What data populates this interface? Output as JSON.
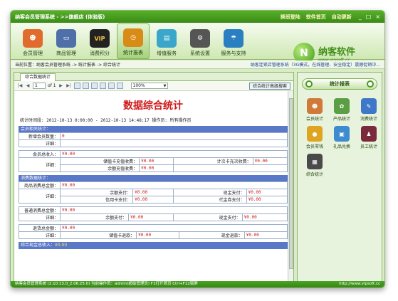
{
  "window": {
    "title": "纳客会员管理系统 - >>旗舰店 (体验版)",
    "links": [
      "换班登陆",
      "软件首页",
      "自动更新"
    ],
    "controls": [
      "_",
      "□",
      "×"
    ]
  },
  "toolbar": {
    "items": [
      {
        "label": "会员管理",
        "icon": "members-icon",
        "color": "#e06b2c"
      },
      {
        "label": "商品管理",
        "icon": "monitor-icon",
        "color": "#4f6fa8"
      },
      {
        "label": "消费积分",
        "icon": "vip-icon",
        "color": "#222222",
        "glyph": "VIP"
      },
      {
        "label": "统计报表",
        "icon": "clock-chart-icon",
        "color": "#d98b17"
      },
      {
        "label": "增值服务",
        "icon": "cards-new-icon",
        "color": "#3aa6c9"
      },
      {
        "label": "系统设置",
        "icon": "gear-icon",
        "color": "#555555"
      },
      {
        "label": "服务与支持",
        "icon": "umbrella-icon",
        "color": "#2a7fc0"
      }
    ],
    "active_index": 3
  },
  "logo": {
    "name": "纳客软件",
    "url": "www.vipsoft.cc"
  },
  "breadcrumb": {
    "text": "当前位置：纳客会员管理系统 -> 统计报表 -> 综合统计",
    "marquee": "纳客连锁店管理系统（3G模式，在线管理、安全稳定）震撼促销中..."
  },
  "tab": {
    "label": "综合数据统计"
  },
  "report_toolbar": {
    "page": "1",
    "of": "of 1",
    "zoom": "100%",
    "advanced_search": "综合统计高级搜索"
  },
  "report": {
    "title": "数据综合统计",
    "meta": "统计时间段: 2012-10-13 0:00:00 - 2012-10-13 14:48:17 操作员: 所有操作员",
    "member_section": {
      "header": "会员相关统计：",
      "new_count_label": "新增会员数量：",
      "new_count_value": "0",
      "detail_label": "详细："
    },
    "member_income": {
      "label": "会员总收入：",
      "value": "¥0.00",
      "detail_label": "详细：",
      "recharge_label": "储值卡充值收费：",
      "recharge_value": "¥0.00",
      "count_card_label": "计次卡充次收费：",
      "count_card_value": "¥0.00",
      "balance_recharge_label": "余额充值收费：",
      "balance_recharge_value": "¥0.00"
    },
    "consume_section": {
      "header": "消费数据统计：",
      "goods_label": "商品消费总金额：",
      "goods_value": "¥0.00",
      "detail_label": "详细：",
      "goods_balance_label": "余额支付：",
      "goods_balance_value": "¥0.00",
      "goods_cash_label": "现金支付：",
      "goods_cash_value": "¥0.00",
      "goods_credit_label": "信用卡支付：",
      "goods_credit_value": "¥0.00",
      "goods_voucher_label": "代金券支付：",
      "goods_voucher_value": "¥0.00",
      "normal_label": "普通消费总金额：",
      "normal_value": "¥0.00",
      "normal_balance_label": "余额支付：",
      "normal_balance_value": "¥0.00",
      "normal_cash_label": "现金支付：",
      "normal_cash_value": "¥0.00",
      "refund_label": "退货总金额：",
      "refund_value": "¥0.00",
      "refund_card_label": "储值卡退款：",
      "refund_card_value": "¥0.00",
      "refund_cash_label": "现金退款：",
      "refund_cash_value": "¥0.00"
    },
    "total": {
      "label": "综合现金总收入：",
      "value": "¥0.00"
    }
  },
  "side": {
    "title": "统计报表",
    "items": [
      {
        "label": "会员统计",
        "icon": "member-stats-icon",
        "color": "#d07a3a"
      },
      {
        "label": "产品统计",
        "icon": "product-stats-icon",
        "color": "#5b9e44"
      },
      {
        "label": "消费统计",
        "icon": "consume-stats-icon",
        "color": "#3f78c8"
      },
      {
        "label": "会员零钱",
        "icon": "coin-icon",
        "color": "#e0a423"
      },
      {
        "label": "礼品兑换",
        "icon": "gift-icon",
        "color": "#3e8cd0"
      },
      {
        "label": "员工统计",
        "icon": "staff-stats-icon",
        "color": "#7a2a3a"
      },
      {
        "label": "综合统计",
        "icon": "summary-stats-icon",
        "color": "#4a4a4a"
      }
    ]
  },
  "statusbar": {
    "left": "纳客会员管理系统 (2.10.13.0_2.06.25.0) 当前操作员：admin(超级管理员) F1打开首页 Ctrl+F12锁屏",
    "right": "http://www.vipsoft.cc"
  }
}
